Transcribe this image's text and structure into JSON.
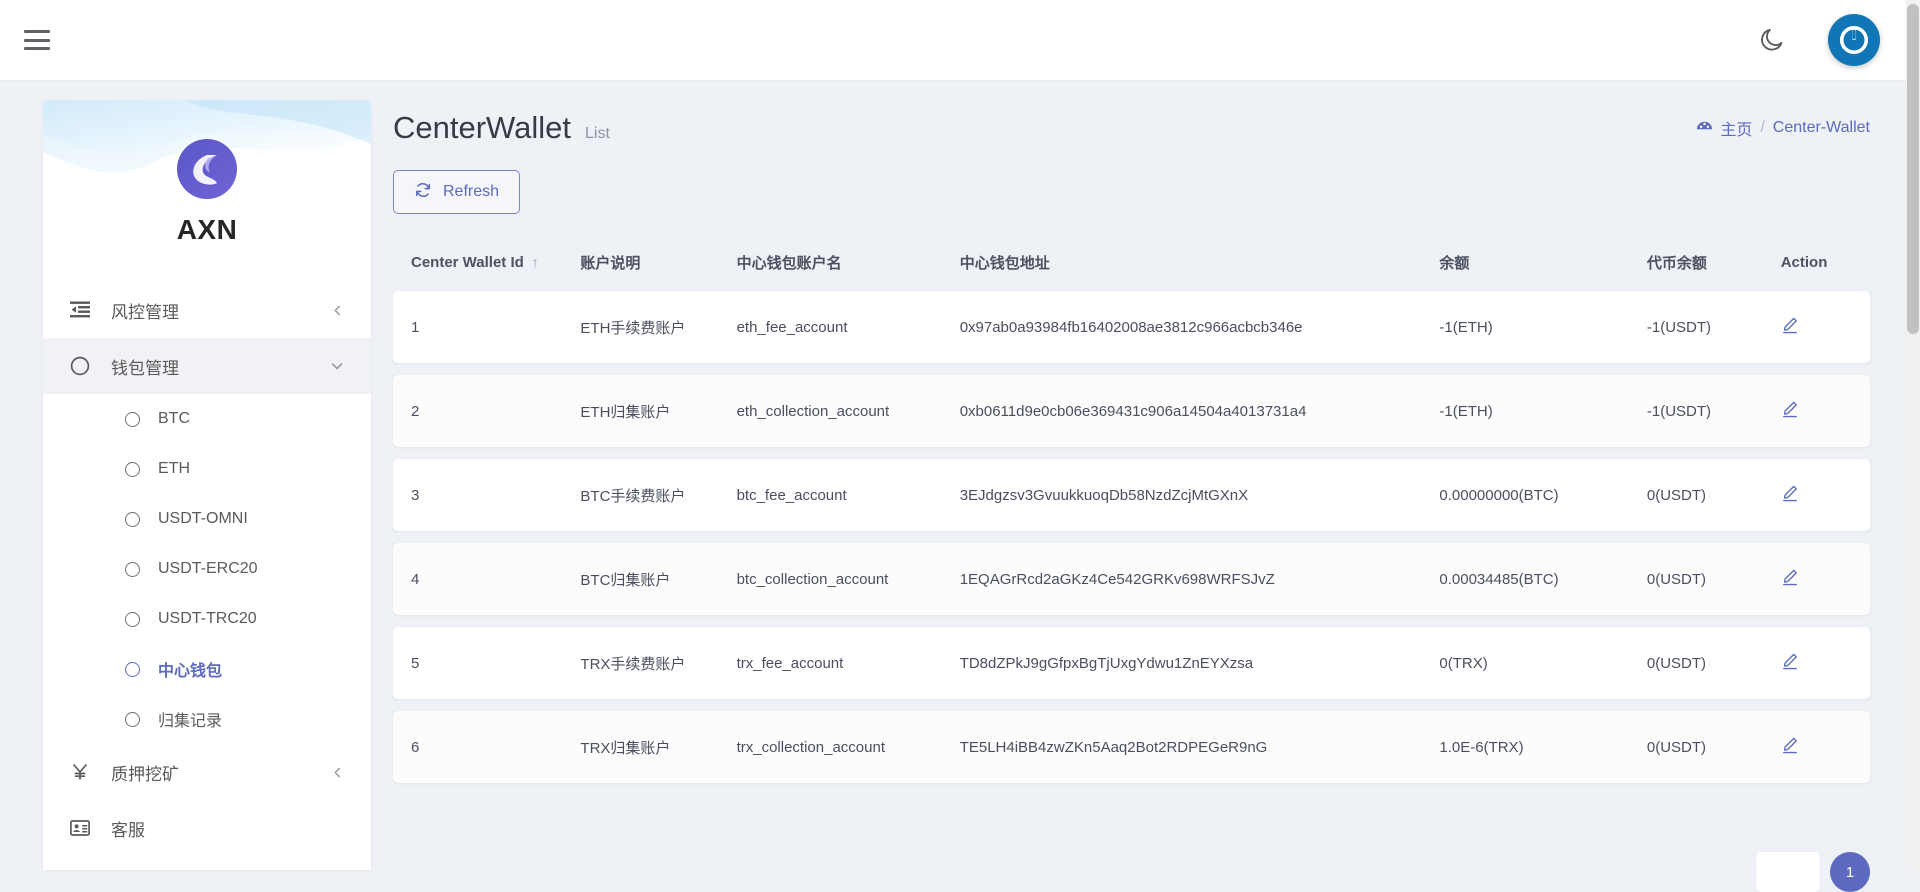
{
  "topbar": {
    "menu_toggle_name": "hamburger-menu",
    "dark_mode_icon": "moon-icon",
    "avatar_icon": "power-logo-avatar"
  },
  "sidebar": {
    "brand": {
      "name": "AXN",
      "logo_icon": "axn-logo-icon"
    },
    "menu": [
      {
        "label": "风控管理",
        "icon": "indent-list-icon",
        "chevron": "chevron-left-icon",
        "expanded": false
      },
      {
        "label": "钱包管理",
        "icon": "circle-icon",
        "chevron": "chevron-down-icon",
        "expanded": true
      },
      {
        "label": "质押挖矿",
        "icon": "yen-icon",
        "chevron": "chevron-left-icon",
        "expanded": false
      },
      {
        "label": "客服",
        "icon": "contact-card-icon",
        "chevron": "",
        "expanded": false
      }
    ],
    "submenu": [
      {
        "label": "BTC",
        "selected": false
      },
      {
        "label": "ETH",
        "selected": false
      },
      {
        "label": "USDT-OMNI",
        "selected": false
      },
      {
        "label": "USDT-ERC20",
        "selected": false
      },
      {
        "label": "USDT-TRC20",
        "selected": false
      },
      {
        "label": "中心钱包",
        "selected": true
      },
      {
        "label": "归集记录",
        "selected": false
      }
    ]
  },
  "page": {
    "title": "CenterWallet",
    "subtitle": "List",
    "breadcrumb": {
      "home_icon": "dashboard-icon",
      "home_label": "主页",
      "separator": "/",
      "current_label": "Center-Wallet"
    },
    "refresh_button": {
      "label": "Refresh",
      "icon": "refresh-icon"
    }
  },
  "table": {
    "columns": [
      {
        "label": "Center Wallet Id",
        "sort": "↑"
      },
      {
        "label": "账户说明",
        "sort": ""
      },
      {
        "label": "中心钱包账户名",
        "sort": ""
      },
      {
        "label": "中心钱包地址",
        "sort": ""
      },
      {
        "label": "余额",
        "sort": ""
      },
      {
        "label": "代币余额",
        "sort": ""
      },
      {
        "label": "Action",
        "sort": ""
      }
    ],
    "rows": [
      {
        "id": "1",
        "desc": "ETH手续费账户",
        "account": "eth_fee_account",
        "address": "0x97ab0a93984fb16402008ae3812c966acbcb346e",
        "balance": "-1(ETH)",
        "token_balance": "-1(USDT)",
        "action_icon": "edit-pencil-icon"
      },
      {
        "id": "2",
        "desc": "ETH归集账户",
        "account": "eth_collection_account",
        "address": "0xb0611d9e0cb06e369431c906a14504a4013731a4",
        "balance": "-1(ETH)",
        "token_balance": "-1(USDT)",
        "action_icon": "edit-pencil-icon"
      },
      {
        "id": "3",
        "desc": "BTC手续费账户",
        "account": "btc_fee_account",
        "address": "3EJdgzsv3GvuukkuoqDb58NzdZcjMtGXnX",
        "balance": "0.00000000(BTC)",
        "token_balance": "0(USDT)",
        "action_icon": "edit-pencil-icon"
      },
      {
        "id": "4",
        "desc": "BTC归集账户",
        "account": "btc_collection_account",
        "address": "1EQAGrRcd2aGKz4Ce542GRKv698WRFSJvZ",
        "balance": "0.00034485(BTC)",
        "token_balance": "0(USDT)",
        "action_icon": "edit-pencil-icon"
      },
      {
        "id": "5",
        "desc": "TRX手续费账户",
        "account": "trx_fee_account",
        "address": "TD8dZPkJ9gGfpxBgTjUxgYdwu1ZnEYXzsa",
        "balance": "0(TRX)",
        "token_balance": "0(USDT)",
        "action_icon": "edit-pencil-icon"
      },
      {
        "id": "6",
        "desc": "TRX归集账户",
        "account": "trx_collection_account",
        "address": "TE5LH4iBB4zwZKn5Aaq2Bot2RDPEGeR9nG",
        "balance": "1.0E-6(TRX)",
        "token_balance": "0(USDT)",
        "action_icon": "edit-pencil-icon"
      }
    ]
  },
  "pagination": {
    "current_page": "1"
  },
  "colors": {
    "accent": "#5c6bc0",
    "avatar_blue": "#1176b5",
    "page_bg": "#eef1f6",
    "panel_bg": "#ffffff"
  }
}
